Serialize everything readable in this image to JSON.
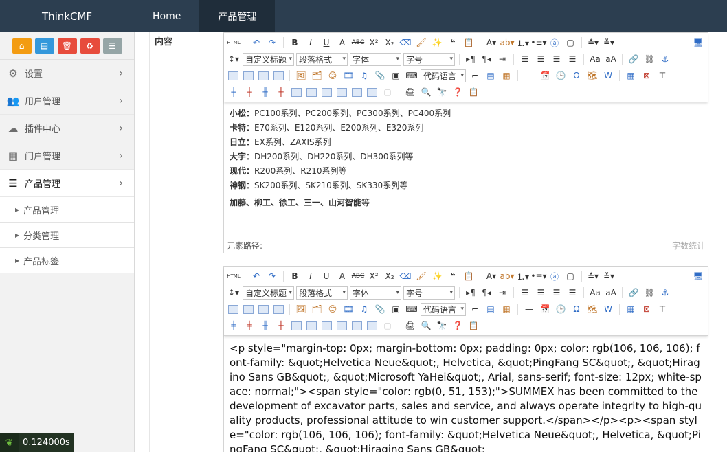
{
  "app": {
    "brand": "ThinkCMF"
  },
  "topnav": [
    {
      "label": "Home",
      "active": false
    },
    {
      "label": "产品管理",
      "active": true
    }
  ],
  "sidebar": {
    "menu": [
      {
        "label": "设置",
        "icon": "gear-icon"
      },
      {
        "label": "用户管理",
        "icon": "users-icon"
      },
      {
        "label": "插件中心",
        "icon": "cloud-icon"
      },
      {
        "label": "门户管理",
        "icon": "grid-icon"
      },
      {
        "label": "产品管理",
        "icon": "list-icon"
      }
    ],
    "submenu": [
      {
        "label": "产品管理"
      },
      {
        "label": "分类管理"
      },
      {
        "label": "产品标签"
      }
    ]
  },
  "form": {
    "content_label": "内容"
  },
  "toolbar": {
    "custom_title": "自定义标题",
    "paragraph": "段落格式",
    "font": "字体",
    "size": "字号",
    "code_lang": "代码语言"
  },
  "editor1": {
    "lines": [
      {
        "brand": "小松：",
        "text": "PC100系列、PC200系列、PC300系列、PC400系列"
      },
      {
        "brand": "卡特：",
        "text": "E70系列、E120系列、E200系列、E320系列"
      },
      {
        "brand": "日立：",
        "text": "EX系列、ZAXIS系列"
      },
      {
        "brand": "大宇：",
        "text": "DH200系列、DH220系列、DH300系列等"
      },
      {
        "brand": "现代：",
        "text": "R200系列、R210系列等"
      },
      {
        "brand": "神钢：",
        "text": "SK200系列、SK210系列、SK330系列等"
      }
    ],
    "last_line_bold": "加藤、柳工、徐工、三一、山河智能",
    "last_line_tail": "等",
    "path_label": "元素路径:",
    "word_count": "字数统计"
  },
  "editor2": {
    "source": "<p style=\"margin-top: 0px; margin-bottom: 0px; padding: 0px; color: rgb(106, 106, 106); font-family: &quot;Helvetica Neue&quot;, Helvetica, &quot;PingFang SC&quot;, &quot;Hiragino Sans GB&quot;, &quot;Microsoft YaHei&quot;, Arial, sans-serif; font-size: 12px; white-space: normal;\"><span style=\"color: rgb(0, 51, 153);\">SUMMEX has been committed to the development of excavator parts, sales and service, and always operate integrity to high-quality products, professional attitude to win customer support.</span></p><p><span style=\"color: rgb(106, 106, 106); font-family: &quot;Helvetica Neue&quot;, Helvetica, &quot;PingFang SC&quot;, &quot;Hiragino Sans GB&quot;"
  },
  "debug": {
    "time": "0.124000s"
  },
  "colors": {
    "topbar": "#2c3e50",
    "active_tab": "#1f2d3a"
  }
}
